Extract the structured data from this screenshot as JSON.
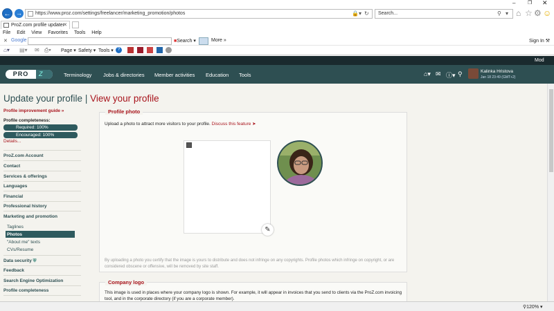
{
  "browser": {
    "url": "https://www.proz.com/settings/freelancer/marketing_promotion/photos",
    "search_value": "Search...",
    "tab_title": "ProZ.com profile updater",
    "menu": [
      "File",
      "Edit",
      "View",
      "Favorites",
      "Tools",
      "Help"
    ],
    "google_label": "Google",
    "google_search": "Search",
    "more_label": "More »",
    "signin": "Sign In",
    "cmd": {
      "page": "Page",
      "safety": "Safety",
      "tools": "Tools"
    },
    "zoom": "120%"
  },
  "site": {
    "top_right": "Mod",
    "logo_left": "PRO",
    "logo_right": "Z",
    "nav": [
      "Terminology",
      "Jobs & directories",
      "Member activities",
      "Education",
      "Tools"
    ],
    "user_name": "Kalinka Hristova",
    "user_time": "Jan 18 23:49 (GMT+2)"
  },
  "header": {
    "update": "Update your profile",
    "sep": "|",
    "view": "View your profile"
  },
  "sidebar": {
    "guide": "Profile improvement guide »",
    "completeness_label": "Profile completeness:",
    "required": "Required: 100%",
    "encouraged": "Encouraged: 100%",
    "details": "Details...",
    "sections": [
      "ProZ.com Account",
      "Contact",
      "Services & offerings",
      "Languages",
      "Financial",
      "Professional history",
      "Marketing and promotion"
    ],
    "subitems": [
      "Taglines",
      "Photos",
      "\"About me\" texts",
      "CVs/Resume"
    ],
    "sections2": [
      "Data security",
      "Feedback",
      "Search Engine Optimization",
      "Profile completeness"
    ]
  },
  "photo_panel": {
    "title": "Profile photo",
    "intro": "Upload a photo to attract more visitors to your profile.",
    "discuss": "Discuss this feature",
    "disclaimer": "By uploading a photo you certify that the image is yours to distribute and does not infringe on any copyrights. Profile photos which infringe on copyright, or are considered obscene or offensive, will be removed by site staff."
  },
  "logo_panel": {
    "title": "Company logo",
    "text": "This image is used in places where your company logo is shown. For example, it will appear in invoices that you send to clients via the ProZ.com invoicing tool, and in the corporate directory (if you are a corporate member)."
  },
  "colors": {
    "accent": "#a8141c",
    "nav": "#2e4f52",
    "page_bg": "#f4f3ee"
  }
}
